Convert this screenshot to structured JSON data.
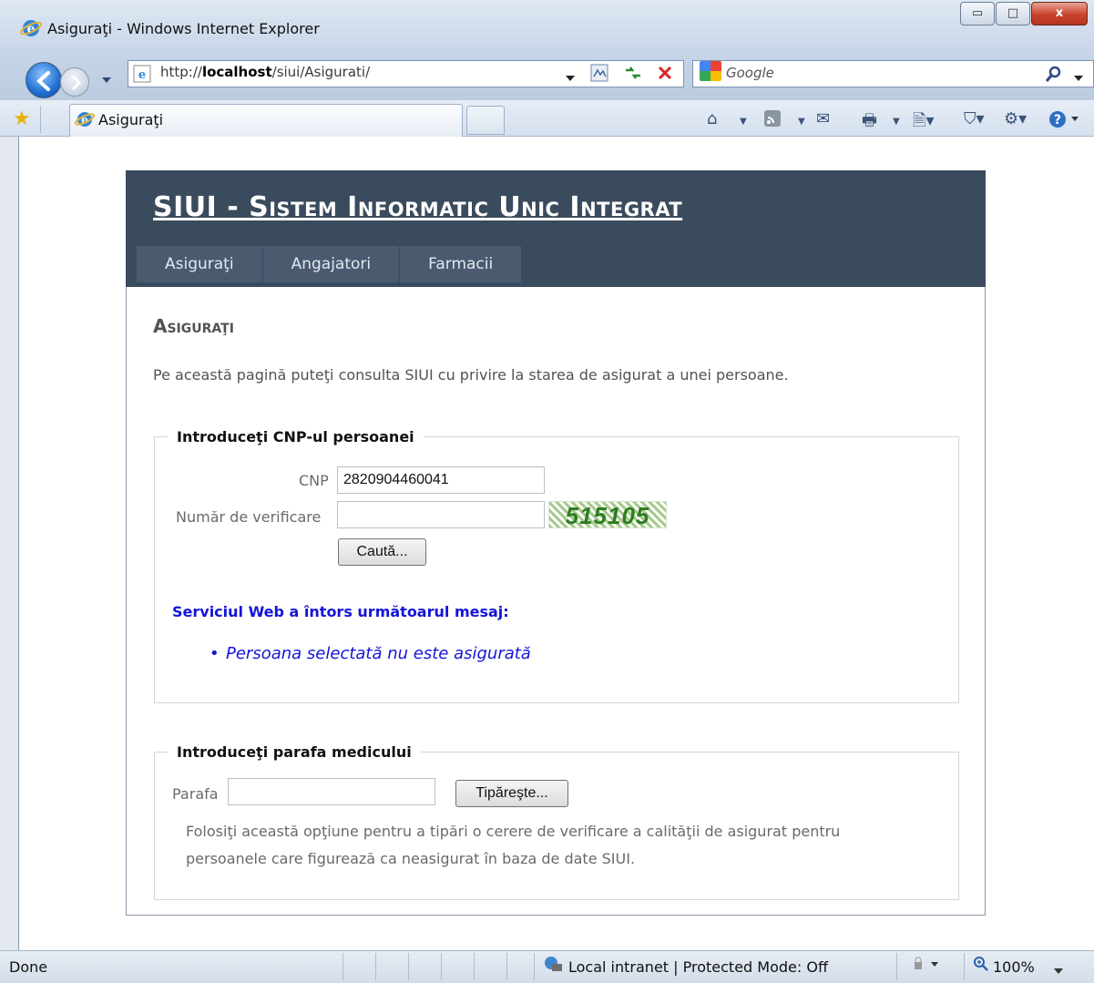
{
  "window": {
    "title": "Asiguraţi - Windows Internet Explorer",
    "minimize_glyph": "▭",
    "maximize_glyph": "□",
    "close_glyph": "x"
  },
  "browser": {
    "address_prefix": "http://",
    "address_host": "localhost",
    "address_path": "/siui/Asigurati/",
    "search_placeholder": "Google",
    "tab_label": "Asiguraţi",
    "zoom": "100%"
  },
  "site": {
    "title": "SIUI - Sistem Informatic Unic Integrat",
    "menu": [
      "Asiguraţi",
      "Angajatori",
      "Farmacii"
    ]
  },
  "page": {
    "heading": "Asiguraţi",
    "intro": "Pe această pagină puteţi consulta SIUI cu privire la starea de asigurat a unei persoane."
  },
  "cnp_form": {
    "legend": "Introduceţi CNP-ul persoanei",
    "cnp_label": "CNP",
    "cnp_value": "2820904460041",
    "verify_label": "Număr de verificare",
    "verify_value": "",
    "captcha": "515105",
    "search_button": "Caută..."
  },
  "ws_result": {
    "heading": "Serviciul Web a întors următoarul mesaj:",
    "bullet": "•",
    "message": "Persoana selectată nu este asigurată"
  },
  "parafa_form": {
    "legend": "Introduceţi parafa medicului",
    "parafa_label": "Parafa",
    "parafa_value": "",
    "print_button": "Tipăreşte...",
    "note": "Folosiţi această opţiune pentru a tipări o cerere de verificare a calităţii de asigurat pentru persoanele care figurează ca neasigurat în baza de date SIUI."
  },
  "status": {
    "left": "Done",
    "zone": "Local intranet | Protected Mode: Off",
    "zoom": "100%"
  },
  "colors": {
    "header_bg": "#3b4b5e",
    "menu_bg": "#4a5b70",
    "message_blue": "#1414d8"
  }
}
